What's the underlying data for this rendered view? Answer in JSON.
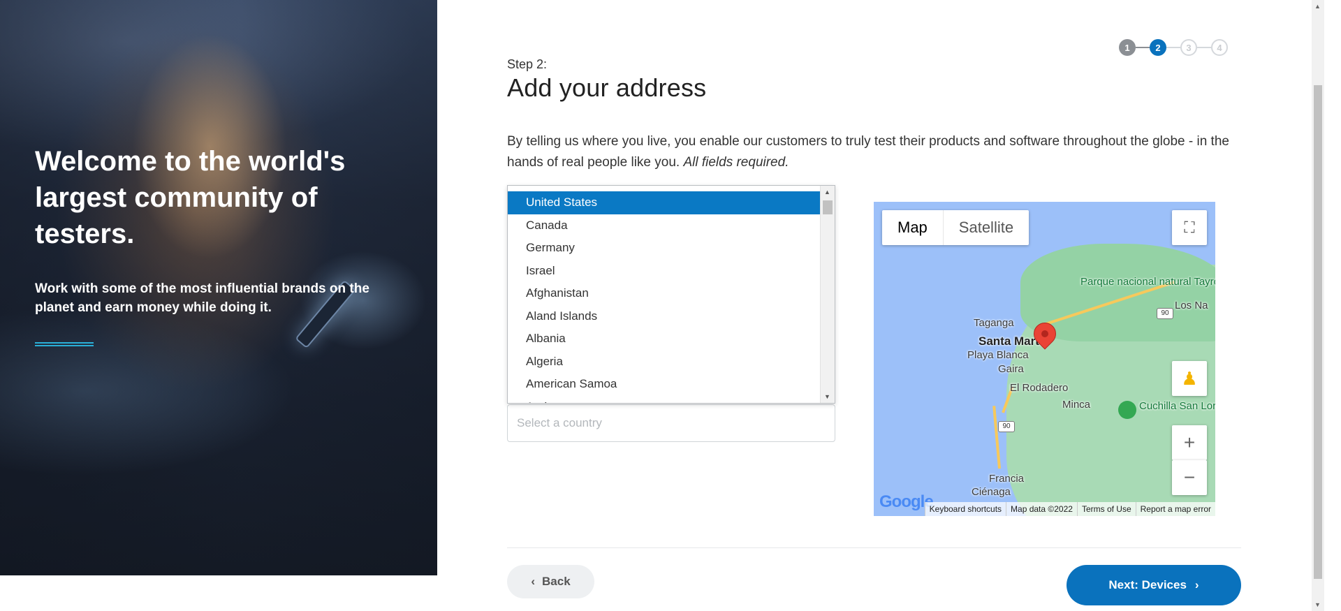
{
  "hero": {
    "title": "Welcome to the world's largest community of testers.",
    "subtitle": "Work with some of the most influential brands on the planet and earn money while doing it."
  },
  "stepper": {
    "steps": [
      "1",
      "2",
      "3",
      "4"
    ],
    "current": 2
  },
  "form": {
    "step_label": "Step 2:",
    "title": "Add your address",
    "intro": "By telling us where you live, you enable our customers to truly test their products and software throughout the globe - in the hands of real people like you.",
    "intro_emphasis": "All fields required.",
    "country_placeholder": "Select a country"
  },
  "country_list": {
    "items": [
      "United States",
      "Canada",
      "Germany",
      "Israel",
      "Afghanistan",
      "Aland Islands",
      "Albania",
      "Algeria",
      "American Samoa",
      "Andorra"
    ],
    "selected": "United States"
  },
  "map": {
    "mode_buttons": [
      "Map",
      "Satellite"
    ],
    "active_mode": "Map",
    "labels": {
      "park": "Parque nacional natural Tayrona",
      "city": "Santa Marta",
      "taganga": "Taganga",
      "playa_blanca": "Playa Blanca",
      "gaira": "Gaira",
      "rodadero": "El Rodadero",
      "minca": "Minca",
      "cuchilla": "Cuchilla San Lorenzo",
      "francia": "Francia",
      "cienaga": "Ciénaga",
      "los_naranjos": "Los Na"
    },
    "road_shields": [
      "90",
      "90"
    ],
    "footer": [
      "Keyboard shortcuts",
      "Map data ©2022",
      "Terms of Use",
      "Report a map error"
    ],
    "logo": "Google"
  },
  "nav": {
    "back_label": "Back",
    "next_label": "Next: Devices"
  },
  "colors": {
    "primary": "#0a72bd",
    "selected": "#0a79c4",
    "accent_line": "#2ab0d8"
  }
}
